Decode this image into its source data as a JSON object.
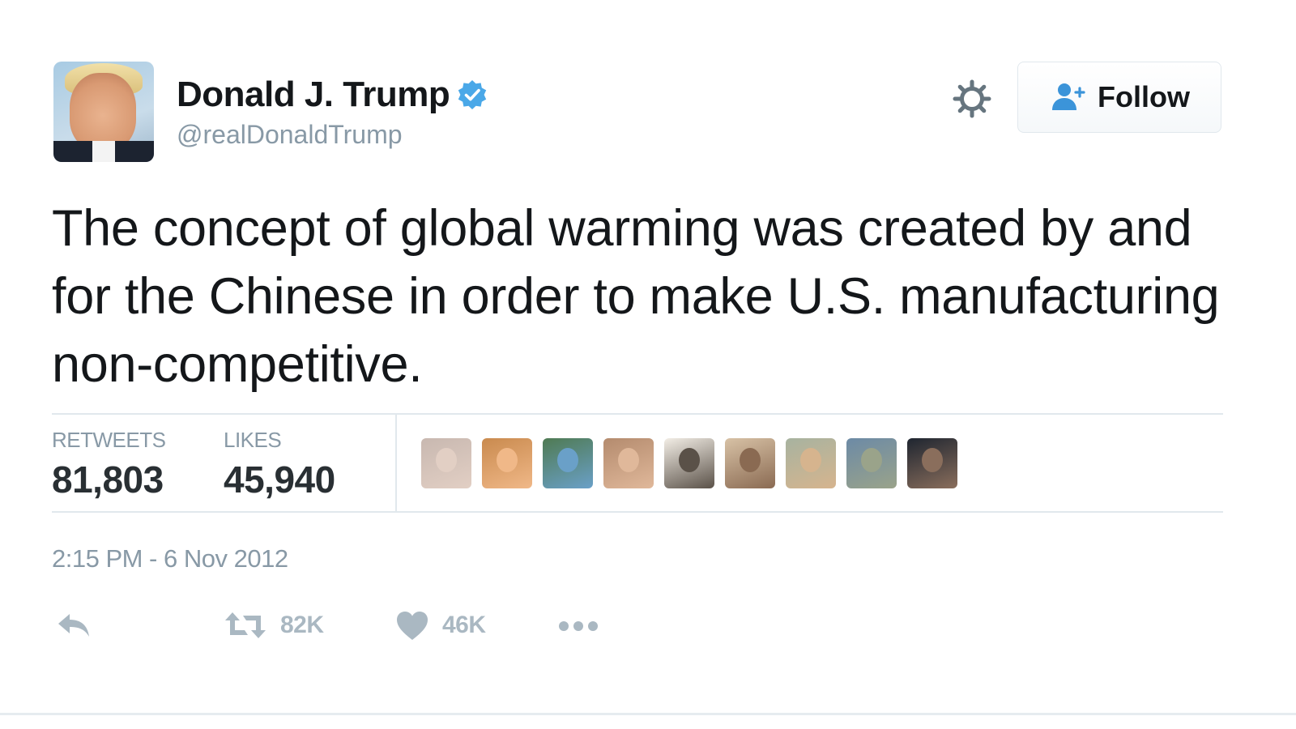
{
  "user": {
    "name": "Donald J. Trump",
    "handle": "@realDonaldTrump",
    "verified": true,
    "verified_color": "#1da1f2"
  },
  "header": {
    "settings_icon": "gear-icon",
    "follow_label": "Follow",
    "follow_icon": "add-user-icon",
    "follow_icon_color": "#1da1f2"
  },
  "tweet": {
    "text": "The concept of global warming was created by and for the Chinese in order to make U.S. manufacturing non-competitive."
  },
  "stats": {
    "retweets_label": "RETWEETS",
    "retweets_value": "81,803",
    "likes_label": "LIKES",
    "likes_value": "45,940"
  },
  "likers": [
    {
      "bg": "#c8b8b0",
      "accent": "#e2cfc4"
    },
    {
      "bg": "#c98a4e",
      "accent": "#f0b888"
    },
    {
      "bg": "#4f7a52",
      "accent": "#6aa0c8"
    },
    {
      "bg": "#b48b6e",
      "accent": "#e0b89a"
    },
    {
      "bg": "#f3eee6",
      "accent": "#5a5148"
    },
    {
      "bg": "#d8c2a6",
      "accent": "#8a6a52"
    },
    {
      "bg": "#a7b3a0",
      "accent": "#d6b48e"
    },
    {
      "bg": "#6c8aa6",
      "accent": "#9aa38a"
    },
    {
      "bg": "#1e2530",
      "accent": "#8a6e5c"
    }
  ],
  "timestamp": "2:15 PM - 6 Nov 2012",
  "actions": {
    "reply_icon": "reply-icon",
    "retweet_icon": "retweet-icon",
    "retweet_count": "82K",
    "like_icon": "heart-icon",
    "like_count": "46K",
    "more_icon": "more-dots-icon",
    "icon_color": "#aab8c2"
  }
}
